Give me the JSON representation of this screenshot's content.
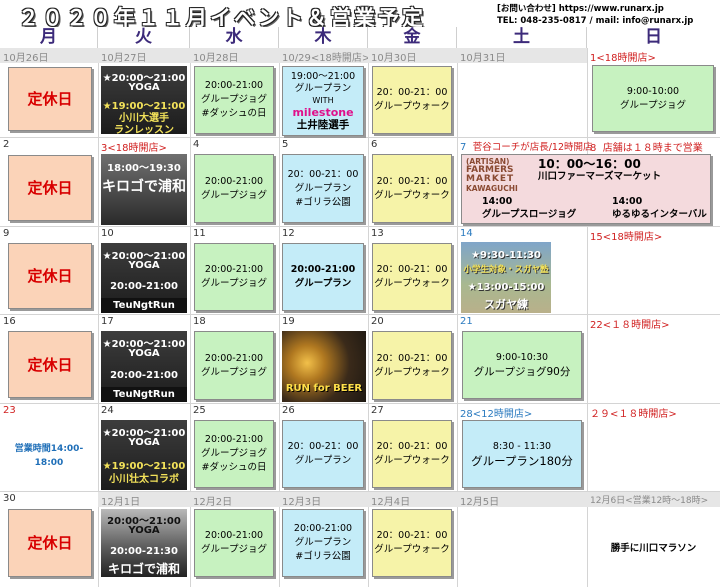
{
  "title": "２０２０年１１月イベント＆営業予定",
  "contact": {
    "line1": "[お問い合わせ] https://www.runarx.jp",
    "line2": "TEL: 048-235-0817 / mail: info@runarx.jp"
  },
  "weekdays": [
    "月",
    "火",
    "水",
    "木",
    "金",
    "土",
    "日"
  ],
  "weeks": [
    {
      "mon": {
        "date": "10月26日",
        "closed": "定休日"
      },
      "tue": {
        "date": "10月27日",
        "l1": "★20:00～21:00",
        "l2": "YOGA",
        "l3": "★19:00～21:00",
        "l4": "小川大選手",
        "l5": "ランレッスン"
      },
      "wed": {
        "date": "10月28日",
        "l1": "20:00-21:00",
        "l2": "グループジョグ",
        "l3": "#ダッシュの日"
      },
      "thu": {
        "date": "10/29<18時開店>",
        "l1": "19:00～21:00",
        "l2": "グループラン",
        "l3": "WITH",
        "l4": "milestone",
        "l5": "土井陸選手"
      },
      "fri": {
        "date": "10月30日",
        "l1": "20：00-21：00",
        "l2": "グループウォーク"
      },
      "sat": {
        "date": "10月31日"
      },
      "sun": {
        "date": "1<18時開店>",
        "l1": "9:00-10:00",
        "l2": "グループジョグ"
      }
    },
    {
      "mon": {
        "date": "2",
        "closed": "定休日"
      },
      "tue": {
        "date": "3<18時開店>",
        "l1": "18:00～19:30",
        "l2": "キロゴで浦和"
      },
      "wed": {
        "date": "4",
        "l1": "20:00-21:00",
        "l2": "グループジョグ"
      },
      "thu": {
        "date": "5",
        "l1": "20：00-21：00",
        "l2": "グループラン",
        "l3": "#ゴリラ公園"
      },
      "fri": {
        "date": "6",
        "l1": "20：00-21：00",
        "l2": "グループウォーク"
      },
      "sat": {
        "date": "7",
        "note": "菅谷コーチが店長/12時開店",
        "logo1": "(ARTISAN)",
        "logo2": "FARMERS",
        "logo3": "MARKET",
        "logo4": "KAWAGUCHI",
        "time1": "10：00～16：00",
        "event1": "川口ファーマーズマーケット",
        "time2": "14:00",
        "event2": "グループスロージョグ"
      },
      "sun": {
        "date": "8",
        "note": "店舗は１８時まで営業",
        "time": "14:00",
        "event": "ゆるゆるインターバル"
      }
    },
    {
      "mon": {
        "date": "9",
        "closed": "定休日"
      },
      "tue": {
        "date": "10",
        "l1": "★20:00～21:00",
        "l2": "YOGA",
        "l3": "20:00-21:00",
        "l4": "TeuNgtRun"
      },
      "wed": {
        "date": "11",
        "l1": "20:00-21:00",
        "l2": "グループジョグ"
      },
      "thu": {
        "date": "12",
        "l1": "20:00-21:00",
        "l2": "グループラン"
      },
      "fri": {
        "date": "13",
        "l1": "20：00-21：00",
        "l2": "グループウォーク"
      },
      "sat": {
        "date": "14",
        "l1": "★9:30-11:30",
        "l2": "小学生対象・スガヤ塾",
        "l3": "★13:00-15:00",
        "l4": "スガヤ練"
      },
      "sun": {
        "date": "15<18時開店>"
      }
    },
    {
      "mon": {
        "date": "16",
        "closed": "定休日"
      },
      "tue": {
        "date": "17",
        "l1": "★20:00～21:00",
        "l2": "YOGA",
        "l3": "20:00-21:00",
        "l4": "TeuNgtRun"
      },
      "wed": {
        "date": "18",
        "l1": "20:00-21:00",
        "l2": "グループジョグ"
      },
      "thu": {
        "date": "19",
        "l1": "RUN for BEER"
      },
      "fri": {
        "date": "20",
        "l1": "20：00-21：00",
        "l2": "グループウォーク"
      },
      "sat": {
        "date": "21",
        "l1": "9:00-10:30",
        "l2": "グループジョグ90分"
      },
      "sun": {
        "date": "22<１８時開店>"
      }
    },
    {
      "mon": {
        "date": "23",
        "l1": "営業時間14:00-",
        "l2": "18:00"
      },
      "tue": {
        "date": "24",
        "l1": "★20:00～21:00",
        "l2": "YOGA",
        "l3": "★19:00～21:00",
        "l4": "小川壮太コラボ"
      },
      "wed": {
        "date": "25",
        "l1": "20:00-21:00",
        "l2": "グループジョグ",
        "l3": "#ダッシュの日"
      },
      "thu": {
        "date": "26",
        "l1": "20：00-21：00",
        "l2": "グループラン"
      },
      "fri": {
        "date": "27",
        "l1": "20：00-21：00",
        "l2": "グループウォーク"
      },
      "sat": {
        "date": "28<12時開店>",
        "l1": "8:30 - 11:30",
        "l2": "グループラン180分"
      },
      "sun": {
        "date": "２９<１８時開店>"
      }
    },
    {
      "mon": {
        "date": "30",
        "closed": "定休日"
      },
      "tue": {
        "date": "12月1日",
        "l1": "20:00～21:00",
        "l2": "YOGA",
        "l3": "20:00-21:30",
        "l4": "キロゴで浦和"
      },
      "wed": {
        "date": "12月2日",
        "l1": "20:00-21:00",
        "l2": "グループジョグ"
      },
      "thu": {
        "date": "12月3日",
        "l1": "20:00-21:00",
        "l2": "グループラン",
        "l3": "#ゴリラ公園"
      },
      "fri": {
        "date": "12月4日",
        "l1": "20：00-21：00",
        "l2": "グループウォーク"
      },
      "sat": {
        "date": "12月5日"
      },
      "sun": {
        "date": "12月6日<営業12時～18時>",
        "l1": "勝手に川口マラソン"
      }
    }
  ]
}
